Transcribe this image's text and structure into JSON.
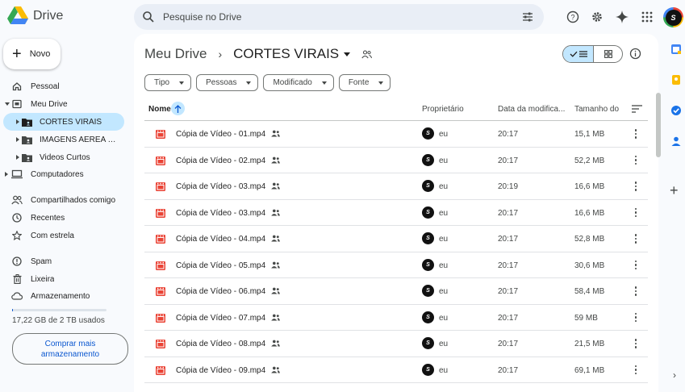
{
  "app": {
    "name": "Drive"
  },
  "search": {
    "placeholder": "Pesquise no Drive"
  },
  "sidebar": {
    "new_label": "Novo",
    "items": [
      {
        "label": "Pessoal",
        "icon": "home-icon"
      },
      {
        "label": "Meu Drive",
        "icon": "drive-icon"
      },
      {
        "label": "CORTES VIRAIS",
        "icon": "shared-folder-icon"
      },
      {
        "label": "IMAGENS AEREA SMETRO",
        "icon": "shared-folder-icon"
      },
      {
        "label": "Videos Curtos",
        "icon": "shared-folder-icon"
      },
      {
        "label": "Computadores",
        "icon": "computer-icon"
      },
      {
        "label": "Compartilhados comigo",
        "icon": "people-icon"
      },
      {
        "label": "Recentes",
        "icon": "clock-icon"
      },
      {
        "label": "Com estrela",
        "icon": "star-icon"
      },
      {
        "label": "Spam",
        "icon": "spam-icon"
      },
      {
        "label": "Lixeira",
        "icon": "trash-icon"
      },
      {
        "label": "Armazenamento",
        "icon": "cloud-icon"
      }
    ],
    "storage_text": "17,22 GB de 2 TB usados",
    "storage_used_fraction": 0.0086,
    "more_storage_label": "Comprar mais armazenamento"
  },
  "breadcrumb": {
    "root": "Meu Drive",
    "current": "CORTES VIRAIS"
  },
  "filters": [
    "Tipo",
    "Pessoas",
    "Modificado",
    "Fonte"
  ],
  "table": {
    "headers": {
      "name": "Nome",
      "owner": "Proprietário",
      "modified": "Data da modifica...",
      "size": "Tamanho do"
    },
    "rows": [
      {
        "name": "Cópia de Vídeo - 01.mp4",
        "owner": "eu",
        "modified": "20:17",
        "size": "15,1 MB"
      },
      {
        "name": "Cópia de Vídeo - 02.mp4",
        "owner": "eu",
        "modified": "20:17",
        "size": "52,2 MB"
      },
      {
        "name": "Cópia de Vídeo - 03.mp4",
        "owner": "eu",
        "modified": "20:19",
        "size": "16,6 MB"
      },
      {
        "name": "Cópia de Vídeo - 03.mp4",
        "owner": "eu",
        "modified": "20:17",
        "size": "16,6 MB"
      },
      {
        "name": "Cópia de Vídeo - 04.mp4",
        "owner": "eu",
        "modified": "20:17",
        "size": "52,8 MB"
      },
      {
        "name": "Cópia de Vídeo - 05.mp4",
        "owner": "eu",
        "modified": "20:17",
        "size": "30,6 MB"
      },
      {
        "name": "Cópia de Vídeo - 06.mp4",
        "owner": "eu",
        "modified": "20:17",
        "size": "58,4 MB"
      },
      {
        "name": "Cópia de Vídeo - 07.mp4",
        "owner": "eu",
        "modified": "20:17",
        "size": "59 MB"
      },
      {
        "name": "Cópia de Vídeo - 08.mp4",
        "owner": "eu",
        "modified": "20:17",
        "size": "21,5 MB"
      },
      {
        "name": "Cópia de Vídeo - 09.mp4",
        "owner": "eu",
        "modified": "20:17",
        "size": "69,1 MB"
      }
    ]
  },
  "colors": {
    "accent": "#0b57d0",
    "selected": "#c2e7ff",
    "video_red": "#ea4335"
  }
}
